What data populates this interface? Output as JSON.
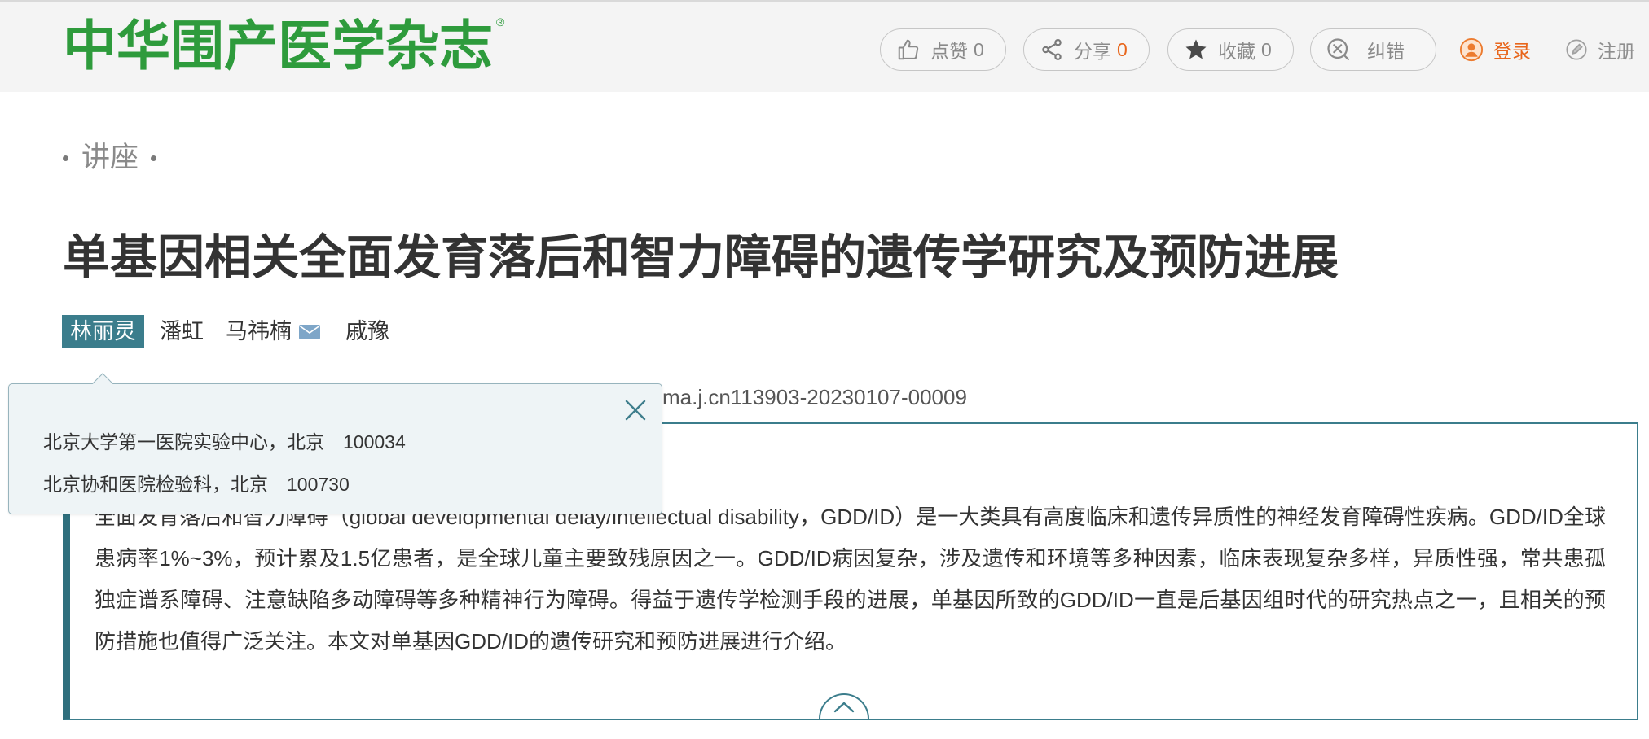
{
  "header": {
    "logo_text": "中华围产医学杂志",
    "logo_mark": "®",
    "actions": {
      "like": {
        "icon": "thumbs-up-icon",
        "label": "点赞",
        "count": "0"
      },
      "share": {
        "icon": "share-icon",
        "label": "分享",
        "count": "0"
      },
      "favorite": {
        "icon": "star-icon",
        "label": "收藏",
        "count": "0"
      },
      "report_error": {
        "icon": "error-correction-icon",
        "label": "纠错"
      },
      "login": {
        "icon": "user-icon",
        "label": "登录"
      },
      "register": {
        "icon": "pencil-icon",
        "label": "注册"
      }
    }
  },
  "article": {
    "section_label": "讲座",
    "title": "单基因相关全面发育落后和智力障碍的遗传学研究及预防进展",
    "authors": [
      {
        "name": "林丽灵",
        "selected": true
      },
      {
        "name": "潘虹"
      },
      {
        "name": "马祎楠",
        "corresponding": true,
        "icon": "envelope-icon"
      },
      {
        "name": "戚豫"
      }
    ],
    "doi_fragment": "ma.j.cn113903-20230107-00009",
    "abstract": "全面发育落后和智力障碍（global developmental delay/intellectual disability，GDD/ID）是一大类具有高度临床和遗传异质性的神经发育障碍性疾病。GDD/ID全球患病率1%~3%，预计累及1.5亿患者，是全球儿童主要致残原因之一。GDD/ID病因复杂，涉及遗传和环境等多种因素，临床表现复杂多样，异质性强，常共患孤独症谱系障碍、注意缺陷多动障碍等多种精神行为障碍。得益于遗传学检测手段的进展，单基因所致的GDD/ID一直是后基因组时代的研究热点之一，且相关的预防措施也值得广泛关注。本文对单基因GDD/ID的遗传研究和预防进展进行介绍。",
    "abstract_toggle_icon": "chevron-up-icon"
  },
  "affiliation_popup": {
    "close_icon": "close-icon",
    "lines": [
      "北京大学第一医院实验中心，北京　100034",
      "北京协和医院检验科，北京　100730"
    ]
  },
  "theme": {
    "brand_green": "#2e9b3c",
    "accent_teal": "#3b7d8c",
    "orange": "#e8661c"
  }
}
